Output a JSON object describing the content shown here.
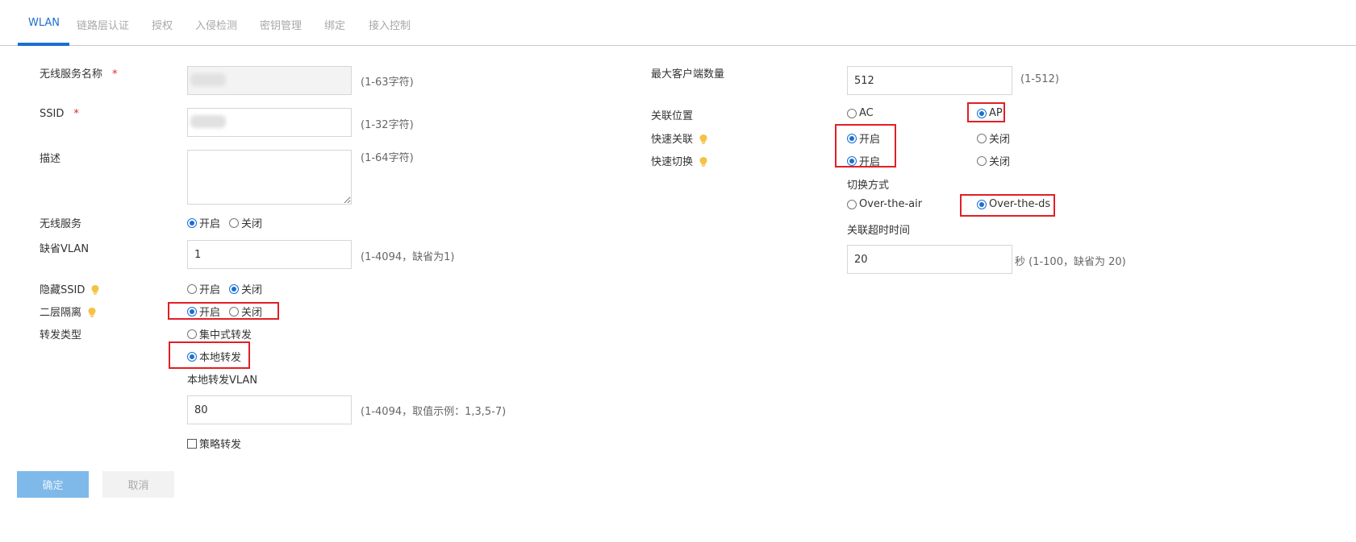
{
  "tabs": [
    "WLAN",
    "链路层认证",
    "授权",
    "入侵检测",
    "密钥管理",
    "绑定",
    "接入控制"
  ],
  "left": {
    "ssid_name": {
      "label": "无线服务名称",
      "required": "*",
      "value": "",
      "hint": "(1-63字符)"
    },
    "ssid": {
      "label": "SSID",
      "required": "*",
      "value": "",
      "hint": "(1-32字符)"
    },
    "description": {
      "label": "描述",
      "value": "",
      "hint": "(1-64字符)"
    },
    "wireless_service": {
      "label": "无线服务",
      "on": "开启",
      "off": "关闭",
      "selected": "on"
    },
    "default_vlan": {
      "label": "缺省VLAN",
      "value": "1",
      "hint": "(1-4094，缺省为1)"
    },
    "hide_ssid": {
      "label": "隐藏SSID",
      "on": "开启",
      "off": "关闭",
      "selected": "off"
    },
    "l2_isolation": {
      "label": "二层隔离",
      "on": "开启",
      "off": "关闭",
      "selected": "on"
    },
    "forward_type": {
      "label": "转发类型",
      "central": "集中式转发",
      "local": "本地转发",
      "selected": "local"
    },
    "local_vlan": {
      "label": "本地转发VLAN",
      "value": "80",
      "hint": "(1-4094，取值示例：1,3,5-7)"
    },
    "policy_forward": {
      "label": "策略转发",
      "checked": false
    }
  },
  "right": {
    "max_clients": {
      "label": "最大客户端数量",
      "value": "512",
      "hint": "(1-512)"
    },
    "assoc_location": {
      "label": "关联位置",
      "ac": "AC",
      "ap": "AP",
      "selected": "ap"
    },
    "fast_assoc": {
      "label": "快速关联",
      "on": "开启",
      "off": "关闭",
      "selected": "on"
    },
    "fast_roam": {
      "label": "快速切换",
      "on": "开启",
      "off": "关闭",
      "selected": "on"
    },
    "roam_mode": {
      "label": "切换方式",
      "air": "Over-the-air",
      "ds": "Over-the-ds",
      "selected": "ds"
    },
    "assoc_timeout": {
      "label": "关联超时时间",
      "value": "20",
      "hint": "秒 (1-100，缺省为 20)"
    }
  },
  "buttons": {
    "ok": "确定",
    "cancel": "取消"
  },
  "colors": {
    "accent": "#1a6fd1",
    "highlight": "#e11f26",
    "required": "#e0262a",
    "bulb": "#f5c242"
  }
}
